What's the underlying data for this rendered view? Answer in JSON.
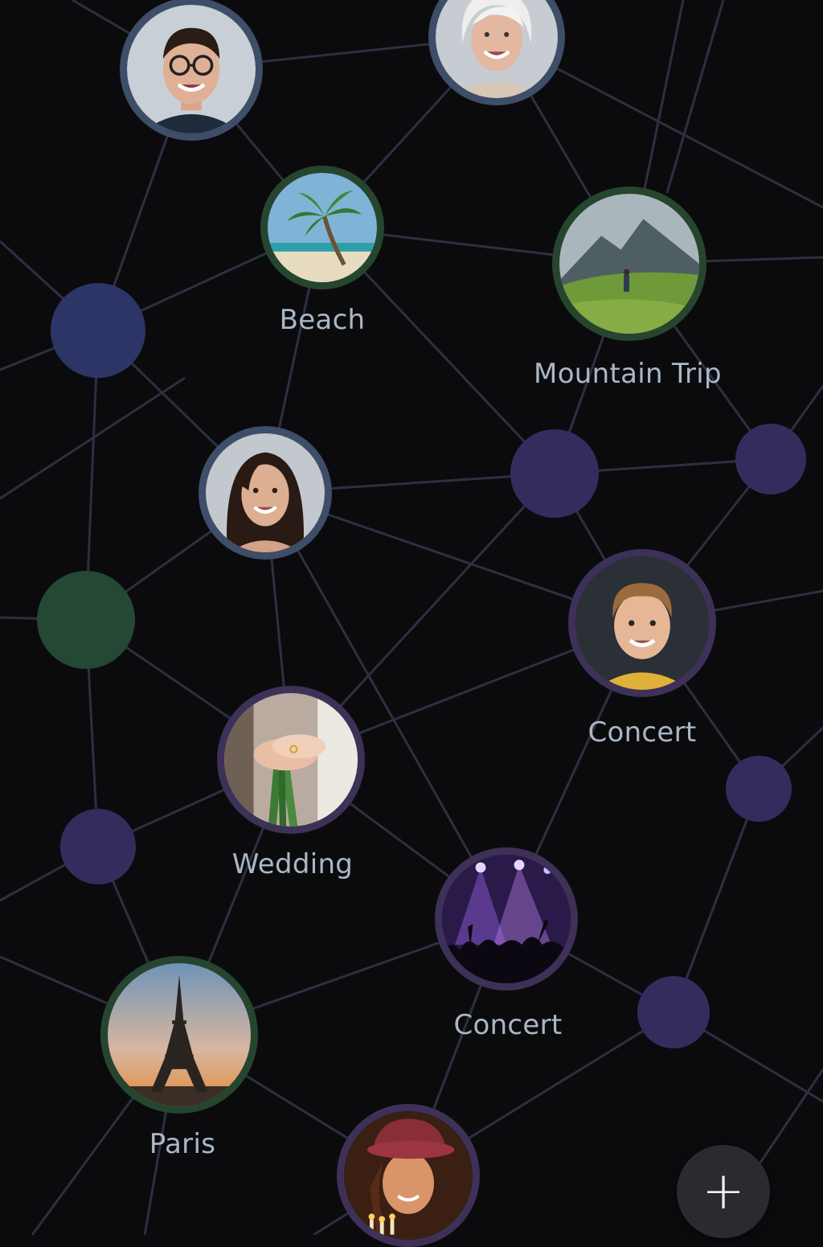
{
  "colors": {
    "background": "#0b0b0e",
    "edge": "#2c3040",
    "label": "#aab7c6",
    "ring_person_blue": "#3e4d68",
    "ring_place_green": "#26452f",
    "ring_event_purple": "#3e3158",
    "dot_navy": "#2d3566",
    "dot_purple": "#352c5e",
    "dot_green": "#244833"
  },
  "nodes": [
    {
      "id": "p-man-glasses",
      "kind": "person",
      "icon": "man-glasses-portrait-icon",
      "label": ""
    },
    {
      "id": "p-older-woman",
      "kind": "person",
      "icon": "older-woman-portrait-icon",
      "label": ""
    },
    {
      "id": "beach",
      "kind": "place",
      "icon": "palm-tree-beach-icon",
      "label": "Beach"
    },
    {
      "id": "mountain",
      "kind": "place",
      "icon": "mountain-landscape-icon",
      "label": "Mountain Trip"
    },
    {
      "id": "p-woman",
      "kind": "person",
      "icon": "woman-portrait-icon",
      "label": ""
    },
    {
      "id": "p-boy",
      "kind": "event",
      "icon": "boy-portrait-icon",
      "label": "Concert"
    },
    {
      "id": "wedding",
      "kind": "event",
      "icon": "holding-hands-bouquet-icon",
      "label": "Wedding"
    },
    {
      "id": "concert",
      "kind": "event",
      "icon": "concert-crowd-lights-icon",
      "label": "Concert"
    },
    {
      "id": "paris",
      "kind": "place",
      "icon": "eiffel-tower-icon",
      "label": "Paris"
    },
    {
      "id": "birthday",
      "kind": "event",
      "icon": "woman-hat-birthday-candles-icon",
      "label": ""
    }
  ],
  "dots": [
    {
      "id": "dot-navy-left",
      "color": "#2d3566"
    },
    {
      "id": "dot-purple-center",
      "color": "#352c5e"
    },
    {
      "id": "dot-purple-right",
      "color": "#352c5e"
    },
    {
      "id": "dot-green-left",
      "color": "#244833"
    },
    {
      "id": "dot-purple-lower-left",
      "color": "#352c5e"
    },
    {
      "id": "dot-purple-lower-right",
      "color": "#352c5e"
    },
    {
      "id": "dot-purple-bottom-right",
      "color": "#352c5e"
    }
  ],
  "fab": {
    "label": "+",
    "icon": "plus-icon"
  }
}
